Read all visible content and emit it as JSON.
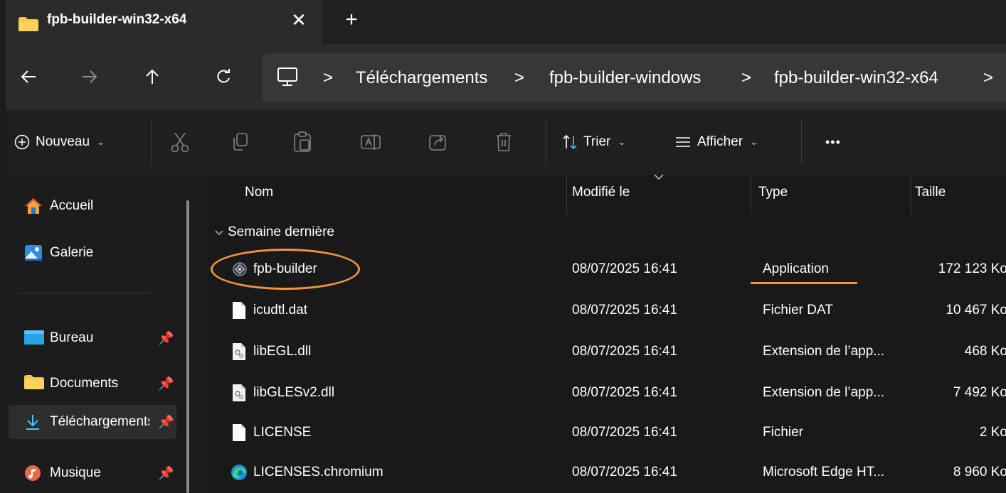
{
  "tab": {
    "title": "fpb-builder-win32-x64",
    "close_glyph": "✕",
    "new_glyph": "+"
  },
  "nav": {
    "back": "←",
    "forward": "→",
    "up": "↑",
    "refresh": "C"
  },
  "breadcrumb": [
    "Téléchargements",
    "fpb-builder-windows",
    "fpb-builder-win32-x64"
  ],
  "breadcrumb_sep": ">",
  "toolbar": {
    "new_label": "Nouveau",
    "sort_label": "Trier",
    "view_label": "Afficher",
    "more_label": "•••"
  },
  "sidebar": {
    "items": [
      {
        "label": "Accueil",
        "icon": "home-icon"
      },
      {
        "label": "Galerie",
        "icon": "gallery-icon"
      },
      {
        "label": "Bureau",
        "icon": "desktop-folder-icon"
      },
      {
        "label": "Documents",
        "icon": "folder-icon"
      },
      {
        "label": "Téléchargements",
        "icon": "download-icon"
      },
      {
        "label": "Musique",
        "icon": "music-icon"
      }
    ]
  },
  "columns": {
    "name": "Nom",
    "modified": "Modifié le",
    "type": "Type",
    "size": "Taille"
  },
  "group": {
    "label": "Semaine dernière"
  },
  "files": [
    {
      "name": "fpb-builder",
      "modified": "08/07/2025 16:41",
      "type": "Application",
      "size": "172 123 Ko",
      "icon": "app-icon"
    },
    {
      "name": "icudtl.dat",
      "modified": "08/07/2025 16:41",
      "type": "Fichier DAT",
      "size": "10 467 Ko",
      "icon": "file-icon"
    },
    {
      "name": "libEGL.dll",
      "modified": "08/07/2025 16:41",
      "type": "Extension de l’app...",
      "size": "468 Ko",
      "icon": "dll-icon"
    },
    {
      "name": "libGLESv2.dll",
      "modified": "08/07/2025 16:41",
      "type": "Extension de l’app...",
      "size": "7 492 Ko",
      "icon": "dll-icon"
    },
    {
      "name": "LICENSE",
      "modified": "08/07/2025 16:41",
      "type": "Fichier",
      "size": "2 Ko",
      "icon": "file-icon"
    },
    {
      "name": "LICENSES.chromium",
      "modified": "08/07/2025 16:41",
      "type": "Microsoft Edge HT...",
      "size": "8 960 Ko",
      "icon": "edge-icon"
    }
  ],
  "colors": {
    "accent": "#f0943a",
    "background": "#191919",
    "selected": "#2d2d2d",
    "folder": "#f7c948",
    "download": "#4cc2ff"
  }
}
